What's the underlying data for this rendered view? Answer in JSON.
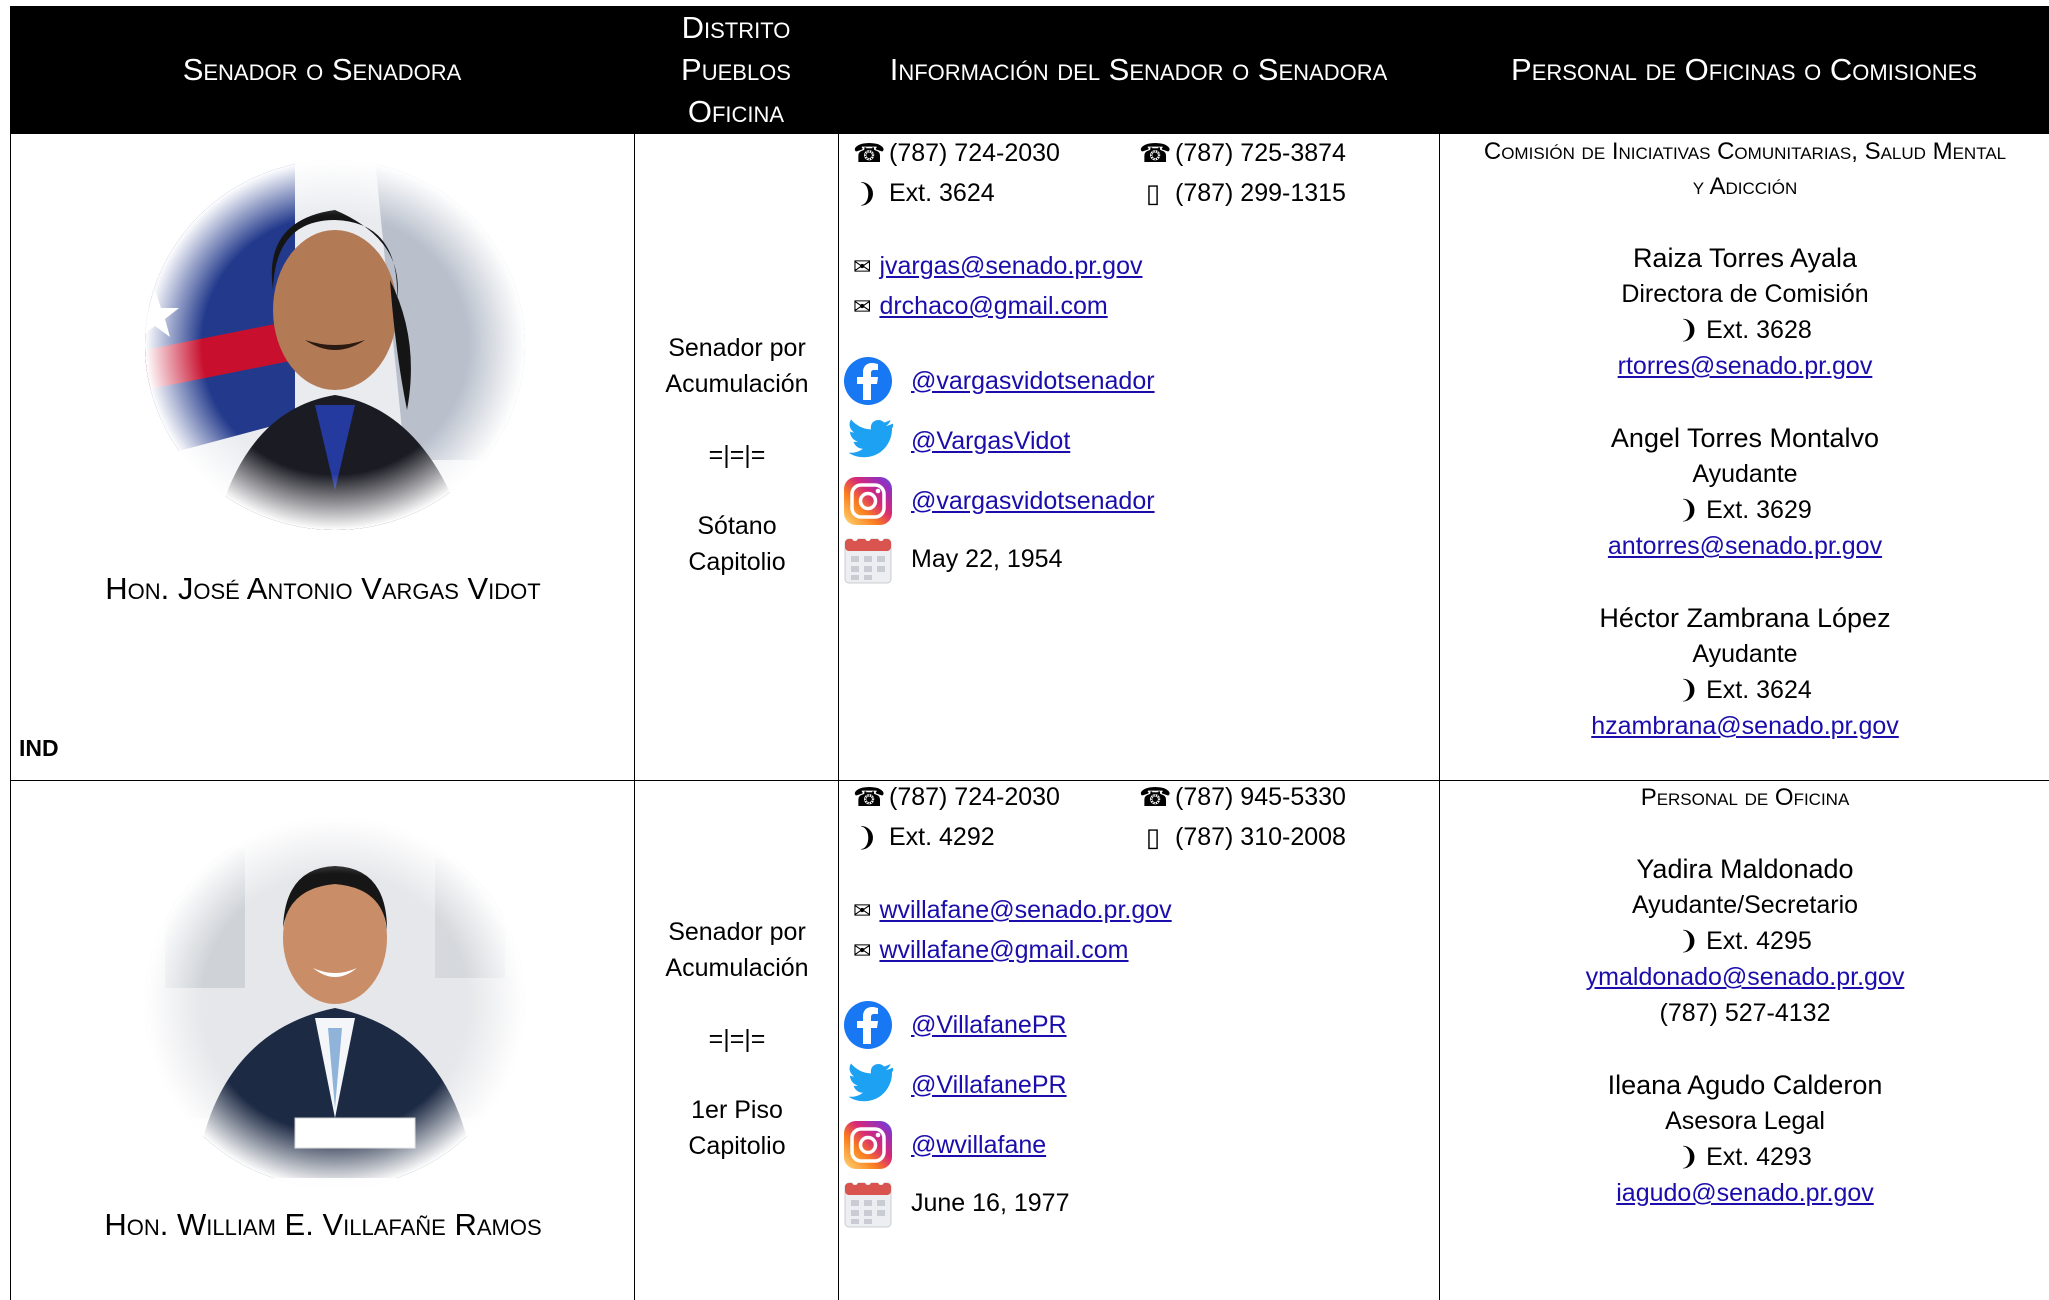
{
  "header": {
    "col1": "Senador o Senadora",
    "col2_line1": "Distrito",
    "col2_line2": "Pueblos",
    "col2_line3": "Oficina",
    "col3": "Información del Senador o Senadora",
    "col4": "Personal de Oficinas o Comisiones"
  },
  "senators": [
    {
      "name": "Hon. José Antonio Vargas Vidot",
      "party": "IND",
      "district_line1": "Senador por",
      "district_line2": "Acumulación",
      "separator": "=|=|=",
      "office_line1": "Sótano",
      "office_line2": "Capitolio",
      "phone1": "(787) 724-2030",
      "ext": "Ext. 3624",
      "phone2": "(787) 725-3874",
      "mobile": "(787) 299-1315",
      "email1": "jvargas@senado.pr.gov",
      "email2": "drchaco@gmail.com",
      "facebook": "@vargasvidotsenador",
      "twitter": "@VargasVidot",
      "instagram": "@vargasvidotsenador",
      "birthday": "May 22, 1954",
      "staff_heading_line1": "Comisión de Iniciativas Comunitarias, Salud Mental",
      "staff_heading_line2": "y Adicción",
      "staff": [
        {
          "name": "Raiza Torres Ayala",
          "role": "Directora de Comisión",
          "ext": "Ext. 3628",
          "email": "rtorres@senado.pr.gov"
        },
        {
          "name": "Angel Torres Montalvo",
          "role": "Ayudante",
          "ext": "Ext. 3629",
          "email": "antorres@senado.pr.gov"
        },
        {
          "name": "Héctor Zambrana López",
          "role": "Ayudante",
          "ext": "Ext. 3624",
          "email": "hzambrana@senado.pr.gov"
        }
      ]
    },
    {
      "name": "Hon. William E. Villafañe Ramos",
      "district_line1": "Senador por",
      "district_line2": "Acumulación",
      "separator": "=|=|=",
      "office_line1": "1er Piso",
      "office_line2": "Capitolio",
      "phone1": "(787) 724-2030",
      "ext": "Ext. 4292",
      "phone2": "(787) 945-5330",
      "mobile": "(787) 310-2008",
      "email1": "wvillafane@senado.pr.gov",
      "email2": "wvillafane@gmail.com",
      "facebook": "@VillafanePR",
      "twitter": "@VillafanePR",
      "instagram": "@wvillafane",
      "birthday": "June 16, 1977",
      "staff_heading_line1": "Personal de Oficina",
      "staff": [
        {
          "name": "Yadira Maldonado",
          "role": "Ayudante/Secretario",
          "ext": "Ext. 4295",
          "email": "ymaldonado@senado.pr.gov",
          "phone": "(787) 527-4132"
        },
        {
          "name": "Ileana Agudo Calderon",
          "role": "Asesora Legal",
          "ext": "Ext. 4293",
          "email": "iagudo@senado.pr.gov"
        }
      ]
    }
  ],
  "icons": {
    "phone": "☎",
    "ext": "❩",
    "mobile": "▯",
    "email": "✉",
    "facebook_color": "#1877f2",
    "twitter_color": "#1da1f2",
    "instagram_color": "#d6249f",
    "calendar_color": "#d9534f"
  }
}
